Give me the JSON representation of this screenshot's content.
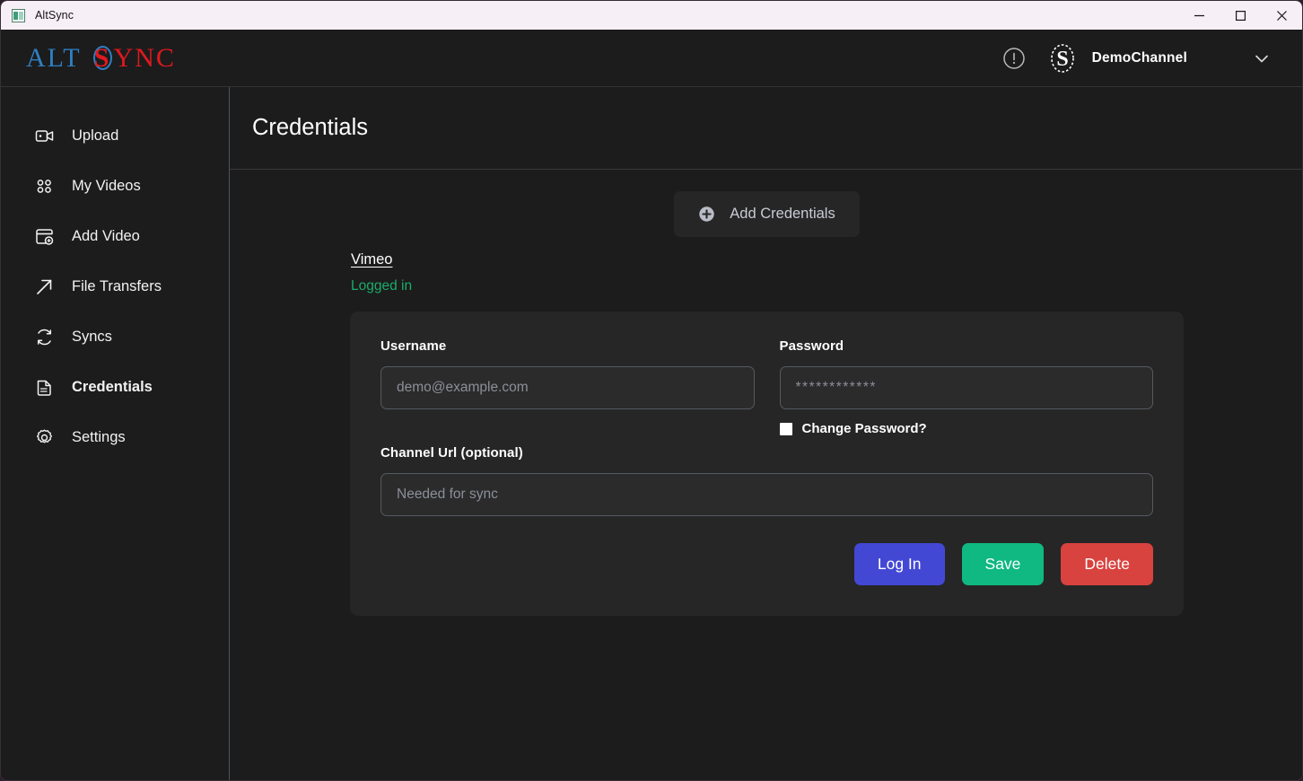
{
  "titlebar": {
    "app_title": "AltSync",
    "app_icon": "app-window-icon",
    "minimize_label": "Minimize",
    "maximize_label": "Maximize",
    "close_label": "Close"
  },
  "header": {
    "brand": {
      "part1": "ALT",
      "letter_s": "S",
      "part2": "YNC"
    },
    "alert_icon": "alert-circle-icon",
    "avatar_icon": "channel-avatar-s-icon",
    "channel_name": "DemoChannel",
    "chevron_icon": "chevron-down-icon"
  },
  "sidebar": {
    "items": [
      {
        "label": "Upload",
        "icon": "video-camera-icon",
        "active": false
      },
      {
        "label": "My Videos",
        "icon": "grid-dots-icon",
        "active": false
      },
      {
        "label": "Add Video",
        "icon": "add-video-icon",
        "active": false
      },
      {
        "label": "File Transfers",
        "icon": "arrow-up-right-icon",
        "active": false
      },
      {
        "label": "Syncs",
        "icon": "refresh-sync-icon",
        "active": false
      },
      {
        "label": "Credentials",
        "icon": "document-icon",
        "active": true
      },
      {
        "label": "Settings",
        "icon": "gear-icon",
        "active": false
      }
    ]
  },
  "main": {
    "page_title": "Credentials",
    "add_credentials": {
      "label": "Add Credentials",
      "icon": "plus-circle-icon"
    },
    "provider": {
      "name": "Vimeo",
      "status": "Logged in",
      "status_color": "#1bab6a"
    },
    "form": {
      "username": {
        "label": "Username",
        "value": "",
        "placeholder": "demo@example.com"
      },
      "password": {
        "label": "Password",
        "value": "************",
        "placeholder": "************"
      },
      "change_password": {
        "label": "Change Password?",
        "checked": false
      },
      "channel_url": {
        "label": "Channel Url (optional)",
        "value": "",
        "placeholder": "Needed for sync"
      },
      "buttons": [
        {
          "label": "Log In",
          "color": "#4348d4",
          "name": "login-button"
        },
        {
          "label": "Save",
          "color": "#0fb981",
          "name": "save-button"
        },
        {
          "label": "Delete",
          "color": "#d8423f",
          "name": "delete-button"
        }
      ]
    }
  }
}
